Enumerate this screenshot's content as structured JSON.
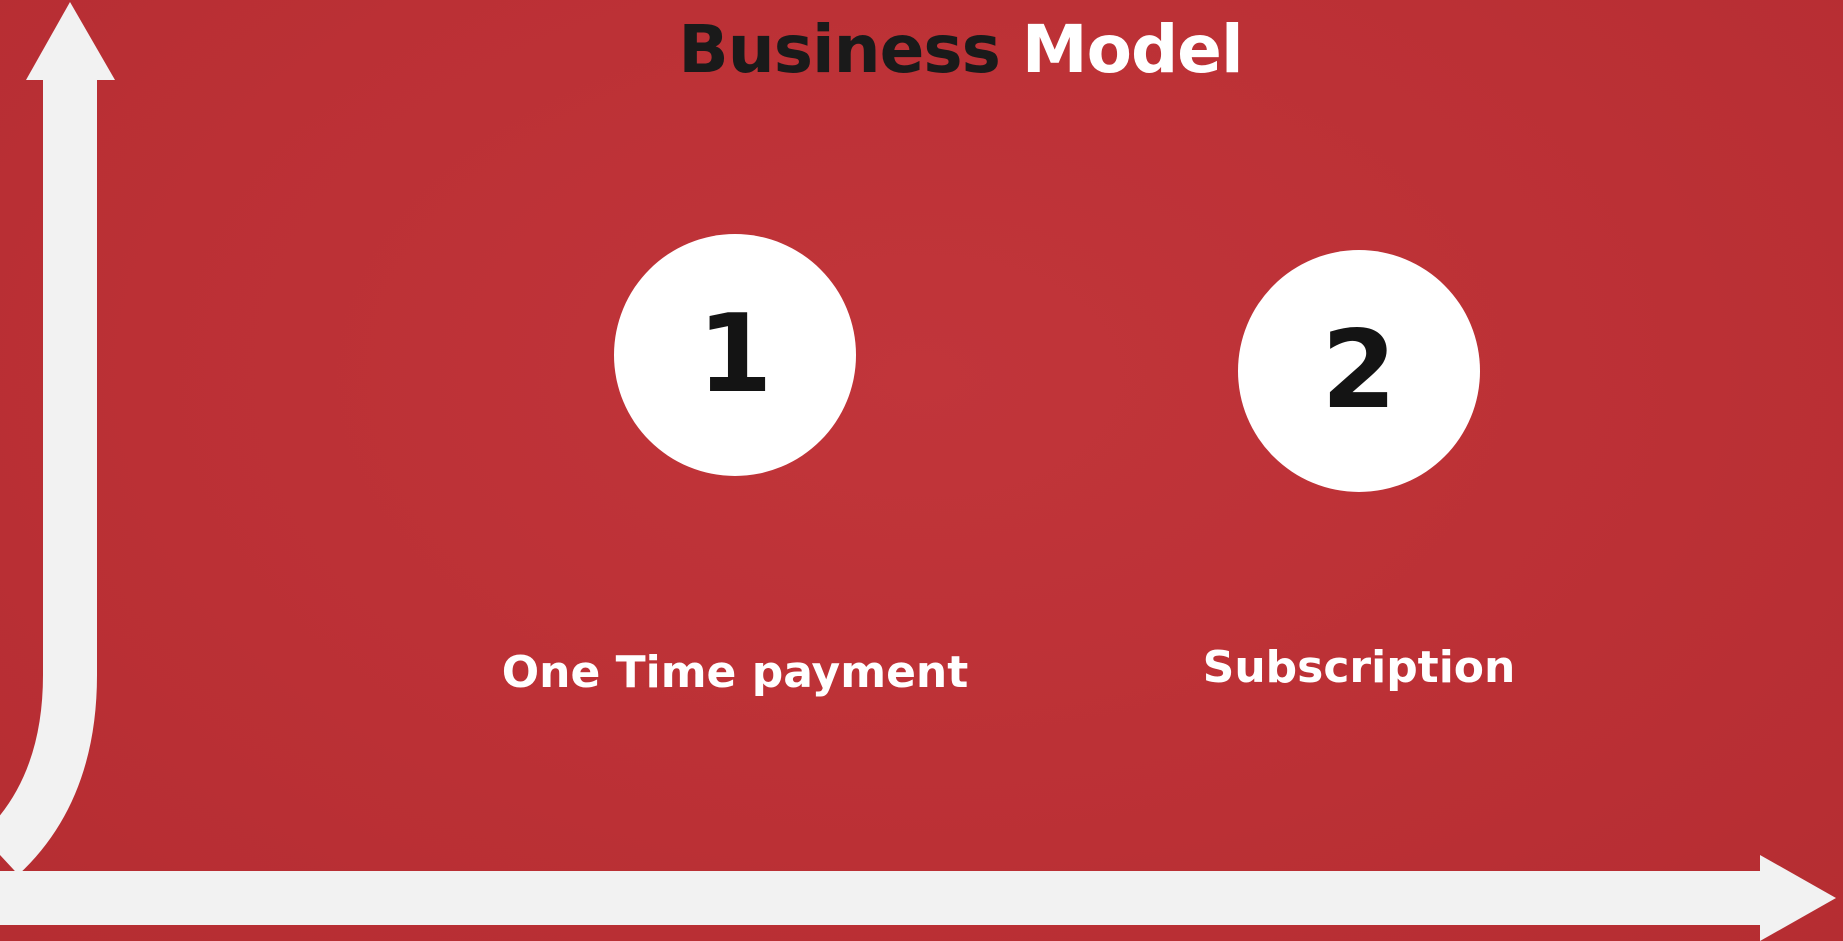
{
  "title": {
    "word1": "Business",
    "word2": "Model"
  },
  "items": [
    {
      "number": "1",
      "label": "One Time payment"
    },
    {
      "number": "2",
      "label": "Subscription"
    }
  ],
  "colors": {
    "background": "#bd3136",
    "arrow": "#f2f2f2",
    "title_dark": "#1a1a1a",
    "text_light": "#ffffff"
  },
  "icons": {
    "vertical_arrow": "arrow-up-icon",
    "horizontal_arrow": "arrow-right-icon"
  }
}
